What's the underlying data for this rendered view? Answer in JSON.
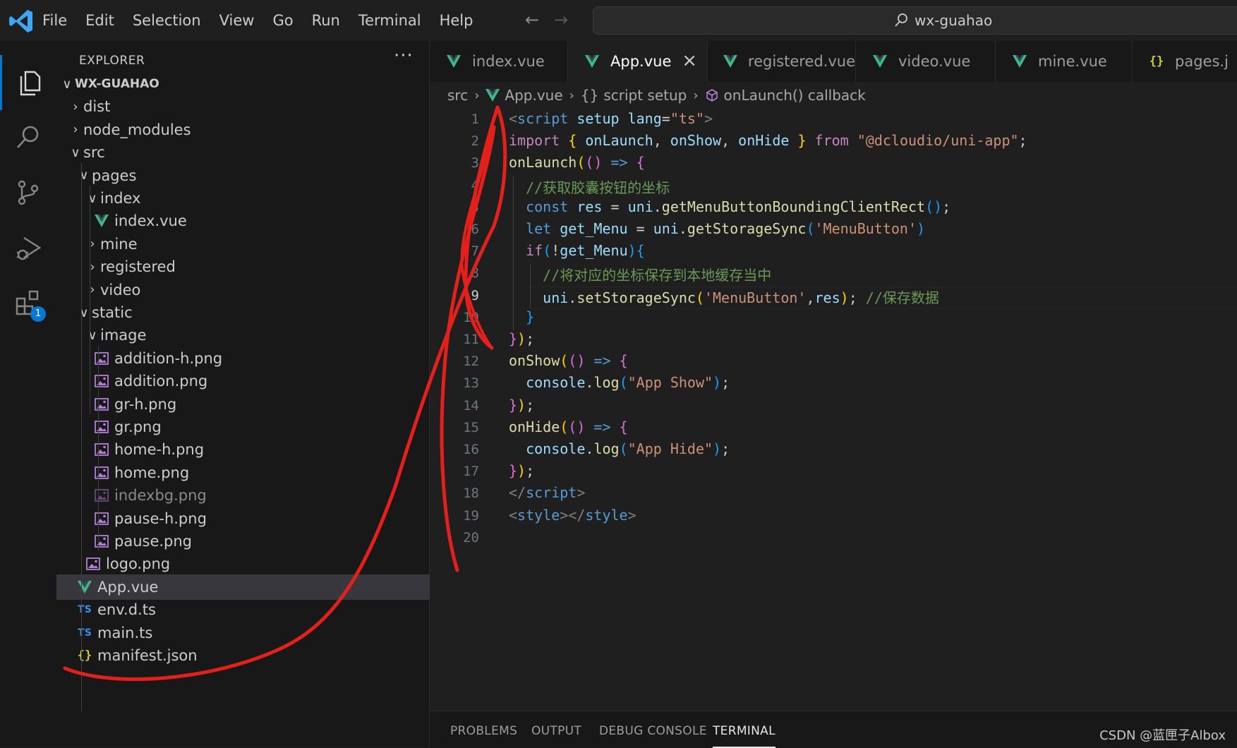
{
  "menu": [
    "File",
    "Edit",
    "Selection",
    "View",
    "Go",
    "Run",
    "Terminal",
    "Help"
  ],
  "search": {
    "text": "wx-guahao"
  },
  "activity": {
    "extensions_badge": "1"
  },
  "explorer": {
    "title": "EXPLORER",
    "more": "···",
    "root": "WX-GUAHAO",
    "tree": [
      {
        "label": "dist",
        "depth": 1,
        "kind": "folder",
        "open": false
      },
      {
        "label": "node_modules",
        "depth": 1,
        "kind": "folder",
        "open": false
      },
      {
        "label": "src",
        "depth": 1,
        "kind": "folder",
        "open": true
      },
      {
        "label": "pages",
        "depth": 2,
        "kind": "folder",
        "open": true
      },
      {
        "label": "index",
        "depth": 3,
        "kind": "folder",
        "open": true
      },
      {
        "label": "index.vue",
        "depth": 4,
        "kind": "vue"
      },
      {
        "label": "mine",
        "depth": 3,
        "kind": "folder",
        "open": false
      },
      {
        "label": "registered",
        "depth": 3,
        "kind": "folder",
        "open": false
      },
      {
        "label": "video",
        "depth": 3,
        "kind": "folder",
        "open": false
      },
      {
        "label": "static",
        "depth": 2,
        "kind": "folder",
        "open": true
      },
      {
        "label": "image",
        "depth": 3,
        "kind": "folder",
        "open": true
      },
      {
        "label": "addition-h.png",
        "depth": 4,
        "kind": "image"
      },
      {
        "label": "addition.png",
        "depth": 4,
        "kind": "image"
      },
      {
        "label": "gr-h.png",
        "depth": 4,
        "kind": "image"
      },
      {
        "label": "gr.png",
        "depth": 4,
        "kind": "image"
      },
      {
        "label": "home-h.png",
        "depth": 4,
        "kind": "image"
      },
      {
        "label": "home.png",
        "depth": 4,
        "kind": "image"
      },
      {
        "label": "indexbg.png",
        "depth": 4,
        "kind": "image",
        "dim": true
      },
      {
        "label": "pause-h.png",
        "depth": 4,
        "kind": "image"
      },
      {
        "label": "pause.png",
        "depth": 4,
        "kind": "image"
      },
      {
        "label": "logo.png",
        "depth": 3,
        "kind": "image"
      },
      {
        "label": "App.vue",
        "depth": 2,
        "kind": "vue",
        "selected": true
      },
      {
        "label": "env.d.ts",
        "depth": 2,
        "kind": "ts"
      },
      {
        "label": "main.ts",
        "depth": 2,
        "kind": "ts"
      },
      {
        "label": "manifest.json",
        "depth": 2,
        "kind": "json"
      }
    ]
  },
  "tabs": [
    {
      "label": "index.vue",
      "kind": "vue"
    },
    {
      "label": "App.vue",
      "kind": "vue",
      "active": true
    },
    {
      "label": "registered.vue",
      "kind": "vue"
    },
    {
      "label": "video.vue",
      "kind": "vue"
    },
    {
      "label": "mine.vue",
      "kind": "vue"
    },
    {
      "label": "pages.j",
      "kind": "json"
    }
  ],
  "breadcrumb": [
    "src",
    "App.vue",
    "script setup",
    "onLaunch() callback"
  ],
  "editor": {
    "current_line": 9,
    "line_numbers": [
      "1",
      "2",
      "3",
      "4",
      "5",
      "6",
      "7",
      "8",
      "9",
      "10",
      "11",
      "12",
      "13",
      "14",
      "15",
      "16",
      "17",
      "18",
      "19",
      "20"
    ],
    "lines": [
      [
        [
          "tg",
          "<"
        ],
        [
          "t",
          "script"
        ],
        [
          "a",
          " setup"
        ],
        [
          "a",
          " lang"
        ],
        [
          "pu",
          "="
        ],
        [
          "s",
          "\"ts\""
        ],
        [
          "tg",
          ">"
        ]
      ],
      [
        [
          "kc",
          "import"
        ],
        [
          "pu",
          " "
        ],
        [
          "p1",
          "{"
        ],
        [
          "v",
          " onLaunch"
        ],
        [
          "pu",
          ","
        ],
        [
          "v",
          " onShow"
        ],
        [
          "pu",
          ","
        ],
        [
          "v",
          " onHide"
        ],
        [
          "pu",
          " "
        ],
        [
          "p1",
          "}"
        ],
        [
          "kc",
          " from"
        ],
        [
          "s",
          " \"@dcloudio/uni-app\""
        ],
        [
          "pu",
          ";"
        ]
      ],
      [
        [
          "f",
          "onLaunch"
        ],
        [
          "p1",
          "("
        ],
        [
          "p2",
          "()"
        ],
        [
          "k",
          " =>"
        ],
        [
          "pu",
          " "
        ],
        [
          "p2",
          "{"
        ]
      ],
      [
        [
          "pu",
          "  "
        ],
        [
          "c",
          "//获取胶囊按钮的坐标"
        ]
      ],
      [
        [
          "pu",
          "  "
        ],
        [
          "k",
          "const"
        ],
        [
          "v",
          " res"
        ],
        [
          "pu",
          " = "
        ],
        [
          "v",
          "uni"
        ],
        [
          "pu",
          "."
        ],
        [
          "f",
          "getMenuButtonBoundingClientRect"
        ],
        [
          "p3",
          "()"
        ],
        [
          "pu",
          ";"
        ]
      ],
      [
        [
          "pu",
          "  "
        ],
        [
          "k",
          "let"
        ],
        [
          "v",
          " get_Menu"
        ],
        [
          "pu",
          " = "
        ],
        [
          "v",
          "uni"
        ],
        [
          "pu",
          "."
        ],
        [
          "f",
          "getStorageSync"
        ],
        [
          "p3",
          "("
        ],
        [
          "s",
          "'MenuButton'"
        ],
        [
          "p3",
          ")"
        ]
      ],
      [
        [
          "pu",
          "  "
        ],
        [
          "kc",
          "if"
        ],
        [
          "p3",
          "("
        ],
        [
          "pu",
          "!"
        ],
        [
          "v",
          "get_Menu"
        ],
        [
          "p3",
          ")"
        ],
        [
          "p3",
          "{"
        ]
      ],
      [
        [
          "pu",
          "    "
        ],
        [
          "c",
          "//将对应的坐标保存到本地缓存当中"
        ]
      ],
      [
        [
          "pu",
          "    "
        ],
        [
          "v",
          "uni"
        ],
        [
          "pu",
          "."
        ],
        [
          "f",
          "setStorageSync"
        ],
        [
          "p1",
          "("
        ],
        [
          "s",
          "'MenuButton'"
        ],
        [
          "pu",
          ","
        ],
        [
          "v",
          "res"
        ],
        [
          "p1",
          ")"
        ],
        [
          "pu",
          "; "
        ],
        [
          "c",
          "//保存数据"
        ]
      ],
      [
        [
          "pu",
          "  "
        ],
        [
          "p3",
          "}"
        ]
      ],
      [
        [
          "p2",
          "}"
        ],
        [
          "p1",
          ")"
        ],
        [
          "pu",
          ";"
        ]
      ],
      [
        [
          "f",
          "onShow"
        ],
        [
          "p1",
          "("
        ],
        [
          "p2",
          "()"
        ],
        [
          "k",
          " =>"
        ],
        [
          "pu",
          " "
        ],
        [
          "p2",
          "{"
        ]
      ],
      [
        [
          "pu",
          "  "
        ],
        [
          "v",
          "console"
        ],
        [
          "pu",
          "."
        ],
        [
          "f",
          "log"
        ],
        [
          "p3",
          "("
        ],
        [
          "s",
          "\"App Show\""
        ],
        [
          "p3",
          ")"
        ],
        [
          "pu",
          ";"
        ]
      ],
      [
        [
          "p2",
          "}"
        ],
        [
          "p1",
          ")"
        ],
        [
          "pu",
          ";"
        ]
      ],
      [
        [
          "f",
          "onHide"
        ],
        [
          "p1",
          "("
        ],
        [
          "p2",
          "()"
        ],
        [
          "k",
          " =>"
        ],
        [
          "pu",
          " "
        ],
        [
          "p2",
          "{"
        ]
      ],
      [
        [
          "pu",
          "  "
        ],
        [
          "v",
          "console"
        ],
        [
          "pu",
          "."
        ],
        [
          "f",
          "log"
        ],
        [
          "p3",
          "("
        ],
        [
          "s",
          "\"App Hide\""
        ],
        [
          "p3",
          ")"
        ],
        [
          "pu",
          ";"
        ]
      ],
      [
        [
          "p2",
          "}"
        ],
        [
          "p1",
          ")"
        ],
        [
          "pu",
          ";"
        ]
      ],
      [
        [
          "tg",
          "</"
        ],
        [
          "t",
          "script"
        ],
        [
          "tg",
          ">"
        ]
      ],
      [
        [
          "tg",
          "<"
        ],
        [
          "t",
          "style"
        ],
        [
          "tg",
          "></"
        ],
        [
          "t",
          "style"
        ],
        [
          "tg",
          ">"
        ]
      ],
      []
    ]
  },
  "panel": {
    "tabs": [
      "PROBLEMS",
      "OUTPUT",
      "DEBUG CONSOLE",
      "TERMINAL"
    ],
    "active": "TERMINAL"
  },
  "watermark": "CSDN @蓝匣子Albox",
  "colors": {
    "accent": "#0078d4",
    "vue_green": "#41b883",
    "annotation_red": "#e3201b"
  }
}
